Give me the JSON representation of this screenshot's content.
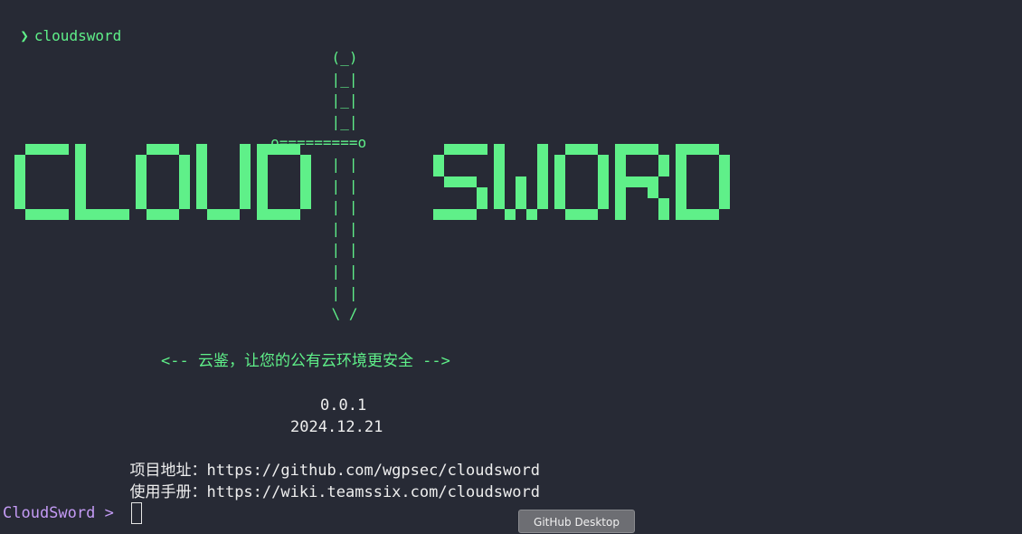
{
  "terminal": {
    "command_glyph": "❯",
    "command": "cloudsword",
    "banner_left": "CLOUD",
    "banner_right": "SWORD",
    "sword_art": [
      "                                             (_)",
      "                                             |_|",
      "                                             |_|",
      "                                             |_|",
      "                                      o=========o",
      "                                             | |",
      "                                             | |",
      "                                             | |",
      "                                             | |",
      "                                             | |",
      "                                             | |",
      "                                             | |",
      "                                             \\ /"
    ],
    "slogan": "<-- 云鉴，让您的公有云环境更安全 -->",
    "version": "0.0.1",
    "date": "2024.12.21",
    "project_label": "项目地址：",
    "project_url": "https://github.com/wgpsec/cloudsword",
    "manual_label": "使用手册：",
    "manual_url": "https://wiki.teamssix.com/cloudsword",
    "prompt": "CloudSword >"
  },
  "tooltip": {
    "text": "GitHub Desktop"
  },
  "colors": {
    "background": "#272a35",
    "accent_green": "#5ff089",
    "prompt_purple": "#c49bf5",
    "text": "#eeeeee"
  }
}
